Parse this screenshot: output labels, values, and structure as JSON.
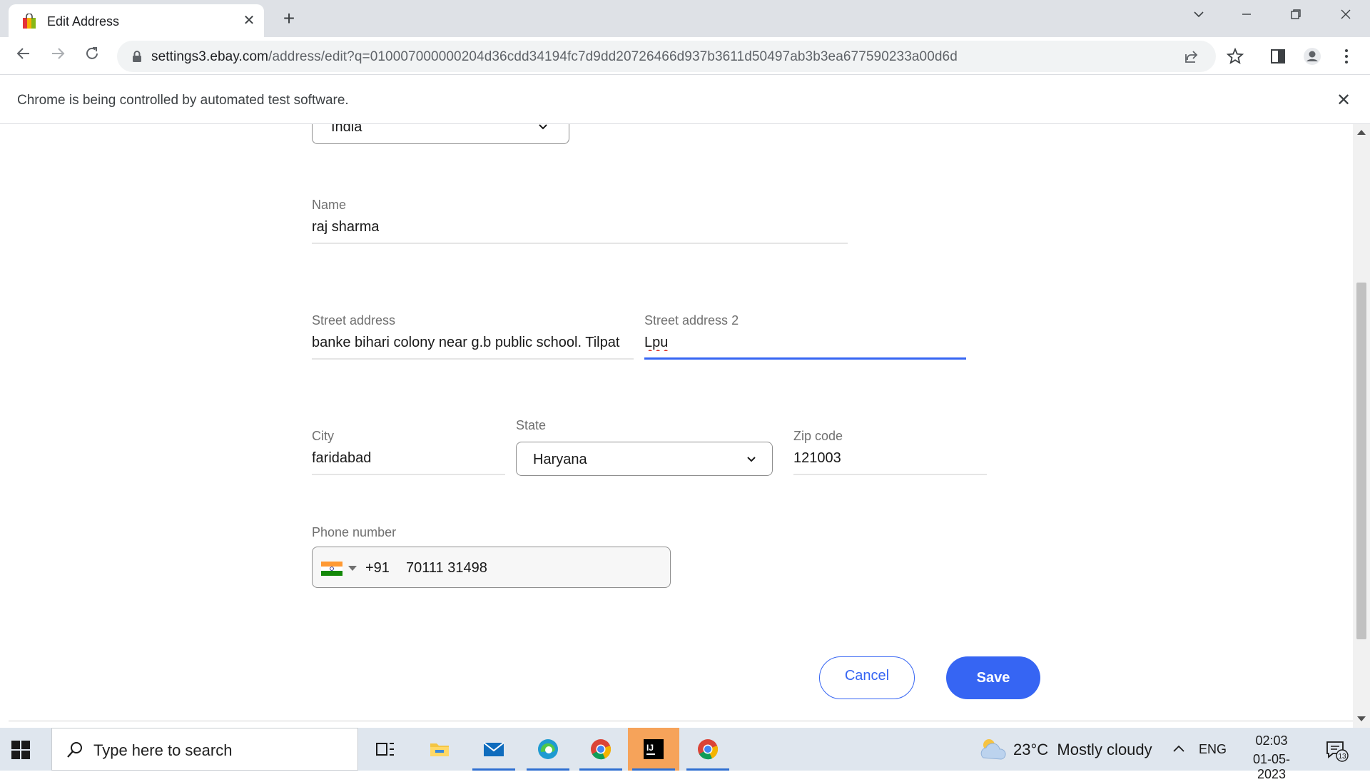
{
  "browser": {
    "tab_title": "Edit Address",
    "url_host": "settings3.ebay.com",
    "url_path": "/address/edit?q=010007000000204d36cdd34194fc7d9dd20726466d937b3611d50497ab3b3ea677590233a00d6d",
    "infobar_text": "Chrome is being controlled by automated test software."
  },
  "form": {
    "country_value": "India",
    "name_label": "Name",
    "name_value": "raj sharma",
    "street_label": "Street address",
    "street_value": "banke bihari colony near g.b public school. Tilpat",
    "street2_label": "Street address 2",
    "street2_value": "Lpu",
    "city_label": "City",
    "city_value": "faridabad",
    "state_label": "State",
    "state_value": "Haryana",
    "zip_label": "Zip code",
    "zip_value": "121003",
    "phone_label": "Phone number",
    "phone_dial_code": "+91",
    "phone_value": "70111 31498",
    "cancel_label": "Cancel",
    "save_label": "Save"
  },
  "taskbar": {
    "search_placeholder": "Type here to search",
    "weather": "23°C  Mostly cloudy",
    "language": "ENG",
    "time": "02:03",
    "date": "01-05-2023",
    "notification_count": "13",
    "apps": [
      "task-view",
      "file-explorer",
      "mail",
      "edge",
      "chrome",
      "intellij",
      "chrome"
    ]
  },
  "colors": {
    "accent": "#3665f3",
    "tabstrip": "#dee1e6",
    "taskbar": "#dfe6ee"
  }
}
